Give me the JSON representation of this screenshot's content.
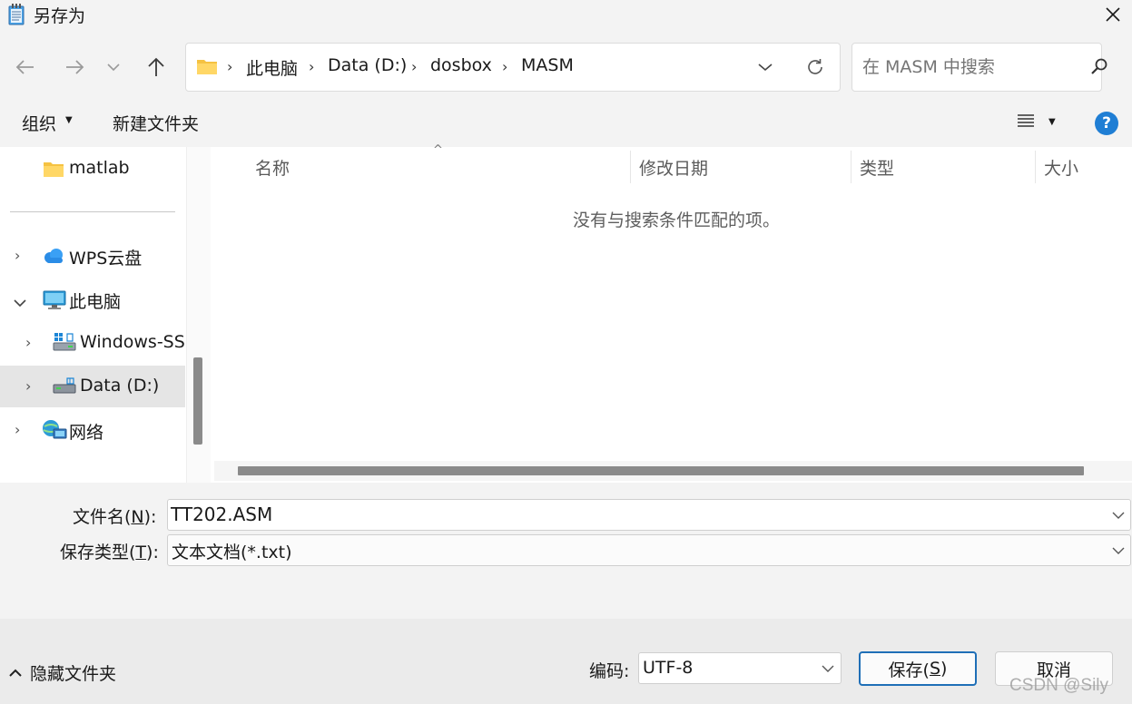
{
  "window": {
    "title": "另存为",
    "close_glyph": "✕"
  },
  "address": {
    "crumbs": [
      "此电脑",
      "Data (D:)",
      "dosbox",
      "MASM"
    ],
    "separator": "›"
  },
  "search": {
    "placeholder": "在 MASM 中搜索"
  },
  "toolbar": {
    "organize_label": "组织",
    "new_folder_label": "新建文件夹",
    "help_glyph": "?"
  },
  "nav": {
    "items": [
      {
        "label": "matlab",
        "icon": "folder-icon"
      },
      {
        "label": "WPS云盘",
        "icon": "cloud-icon"
      },
      {
        "label": "此电脑",
        "icon": "computer-icon"
      },
      {
        "label": "Windows-SS",
        "icon": "windows-drive-icon"
      },
      {
        "label": "Data (D:)",
        "icon": "drive-icon"
      },
      {
        "label": "网络",
        "icon": "network-icon"
      }
    ]
  },
  "filelist": {
    "columns": [
      "名称",
      "修改日期",
      "类型",
      "大小"
    ],
    "empty_message": "没有与搜索条件匹配的项。"
  },
  "fields": {
    "filename_label_prefix": "文件名(",
    "filename_label_key": "N",
    "filename_label_suffix": "):",
    "filename_value": "TT202.ASM",
    "filetype_label_prefix": "保存类型(",
    "filetype_label_key": "T",
    "filetype_label_suffix": "):",
    "filetype_value": "文本文档(*.txt)"
  },
  "bottom": {
    "hide_folders_label": "隐藏文件夹",
    "encoding_label": "编码:",
    "encoding_value": "UTF-8",
    "save_prefix": "保存(",
    "save_key": "S",
    "save_suffix": ")",
    "cancel_label": "取消"
  },
  "watermark": "CSDN @Sily",
  "colors": {
    "accent": "#1f6fb7",
    "help_blue": "#1f7ed4",
    "folder_yellow": "#f5c242"
  }
}
